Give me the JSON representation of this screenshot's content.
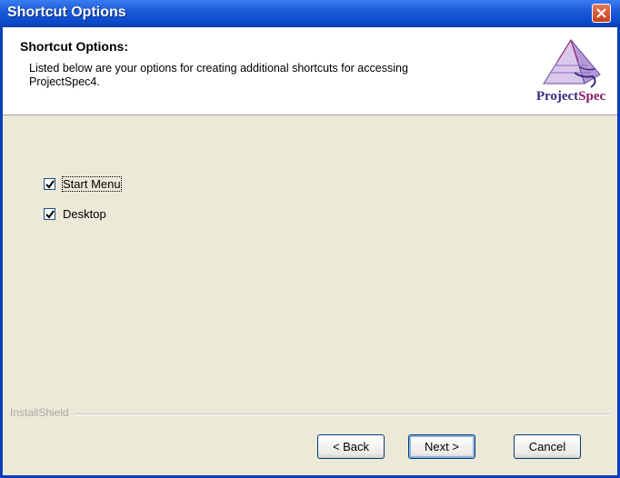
{
  "window": {
    "title": "Shortcut Options"
  },
  "header": {
    "title": "Shortcut Options:",
    "description": "Listed below are your options for creating additional shortcuts for accessing ProjectSpec4."
  },
  "logo": {
    "text_part1": "Project",
    "text_part2": "Spec"
  },
  "options": [
    {
      "label": "Start Menu",
      "checked": true
    },
    {
      "label": "Desktop",
      "checked": true
    }
  ],
  "footer": {
    "brand": "InstallShield"
  },
  "buttons": {
    "back": "< Back",
    "next": "Next >",
    "cancel": "Cancel"
  }
}
